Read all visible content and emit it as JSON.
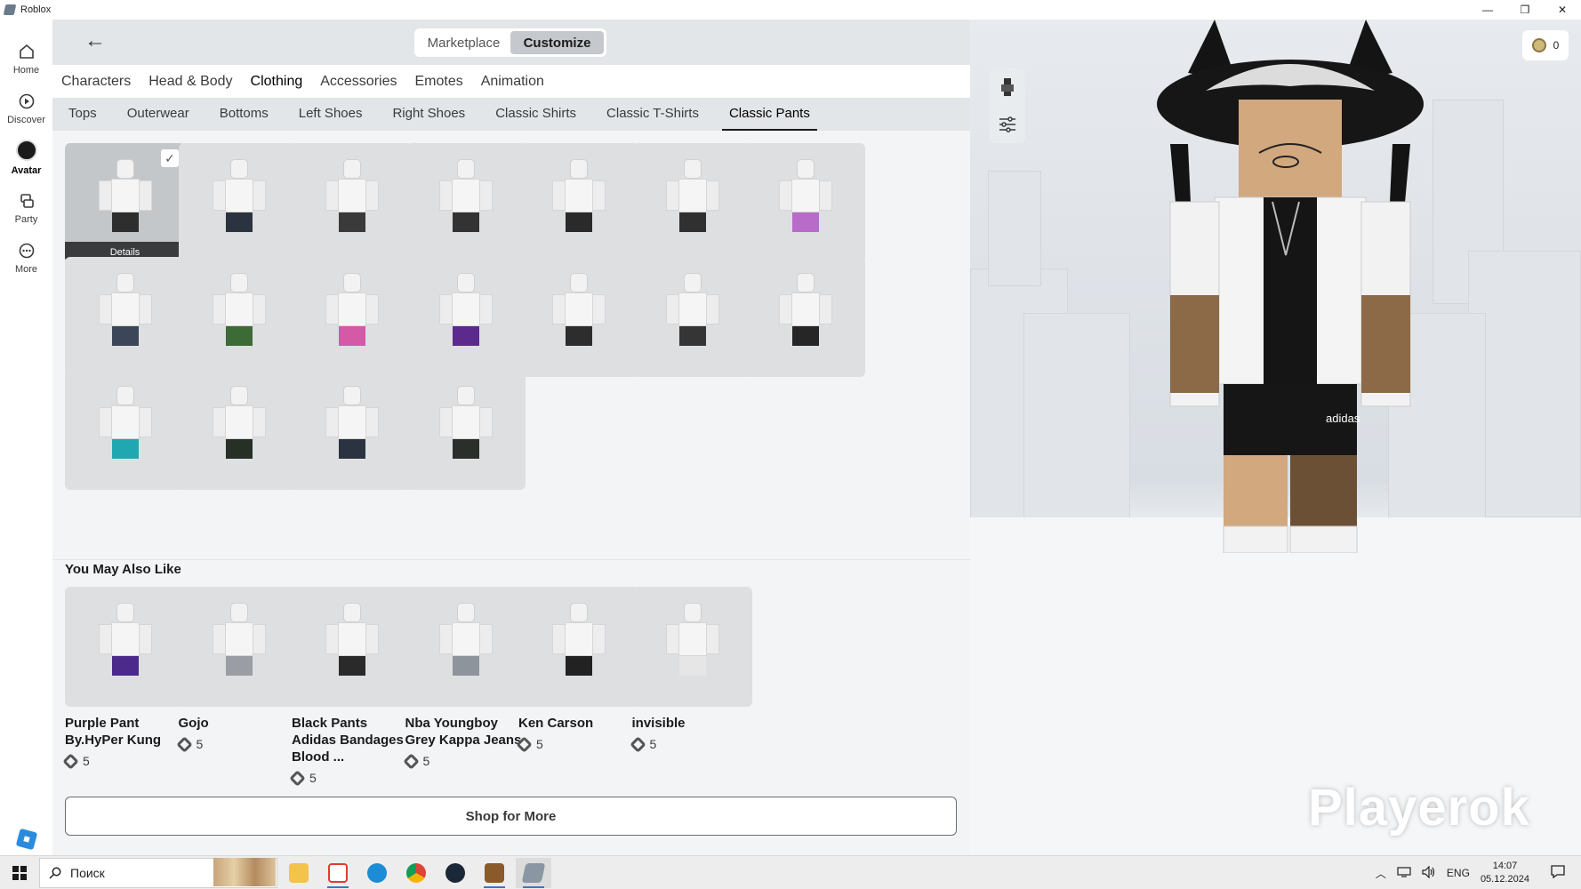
{
  "window": {
    "title": "Roblox",
    "controls": [
      "—",
      "❐",
      "✕"
    ]
  },
  "leftnav": {
    "items": [
      {
        "label": "Home",
        "icon": "home-icon"
      },
      {
        "label": "Discover",
        "icon": "discover-icon"
      },
      {
        "label": "Avatar",
        "icon": "avatar-icon",
        "active": true
      },
      {
        "label": "Party",
        "icon": "party-icon"
      },
      {
        "label": "More",
        "icon": "more-icon"
      }
    ]
  },
  "topbar": {
    "back_glyph": "←",
    "segments": {
      "marketplace": "Marketplace",
      "customize": "Customize"
    },
    "active_segment": "Customize"
  },
  "categories": [
    "Characters",
    "Head & Body",
    "Clothing",
    "Accessories",
    "Emotes",
    "Animation"
  ],
  "active_category": "Clothing",
  "subcategories": [
    "Tops",
    "Outerwear",
    "Bottoms",
    "Left Shoes",
    "Right Shoes",
    "Classic Shirts",
    "Classic T-Shirts",
    "Classic Pants"
  ],
  "active_subcategory": "Classic Pants",
  "inventory": {
    "details_label": "Details",
    "check_glyph": "✓",
    "items": [
      {
        "pants": "#2e2e2e",
        "selected": true
      },
      {
        "pants": "#2c3340"
      },
      {
        "pants": "#3a3a3a"
      },
      {
        "pants": "#333333"
      },
      {
        "pants": "#2a2a2a"
      },
      {
        "pants": "#303030"
      },
      {
        "pants": "#b86bc9"
      },
      {
        "pants": "#3c4658"
      },
      {
        "pants": "#3c6b35"
      },
      {
        "pants": "#d45aa8"
      },
      {
        "pants": "#5c2a8c"
      },
      {
        "pants": "#2d2d2d"
      },
      {
        "pants": "#353535"
      },
      {
        "pants": "#262626"
      },
      {
        "pants": "#1fa8b0"
      },
      {
        "pants": "#263026"
      },
      {
        "pants": "#2c3340"
      },
      {
        "pants": "#2b2f2b"
      }
    ]
  },
  "recommendations": {
    "title": "You May Also Like",
    "items": [
      {
        "name": "Purple Pant By.HyPer Kung",
        "price": "5",
        "pants": "#4b2a8c"
      },
      {
        "name": "Gojo",
        "price": "5",
        "pants": "#9a9ea4"
      },
      {
        "name": "Black Pants Adidas Bandages Blood ...",
        "price": "5",
        "pants": "#2a2a2a"
      },
      {
        "name": "Nba Youngboy Grey Kappa Jeans",
        "price": "5",
        "pants": "#8e949b"
      },
      {
        "name": "Ken Carson",
        "price": "5",
        "pants": "#222222"
      },
      {
        "name": "invisible",
        "price": "5",
        "pants": "#e6e6e6"
      }
    ]
  },
  "shop_more_label": "Shop for More",
  "viewport": {
    "robux_balance": "0",
    "watermark": "Playerok",
    "logo_text": "adidas"
  },
  "taskbar": {
    "search_placeholder": "Поиск",
    "language": "ENG",
    "time": "14:07",
    "date": "05.12.2024"
  },
  "colors": {
    "accent": "#1a1b1d",
    "panel": "#f2f4f5",
    "tile": "#dddfe1",
    "selected_tile": "#c4c7ca"
  }
}
